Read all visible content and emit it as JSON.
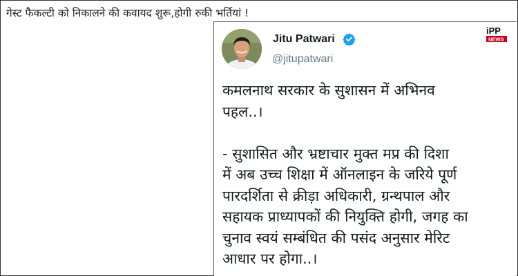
{
  "headline": "गेस्ट फैकल्टी को निकालने की कवायद शुरू,होगी रुकी भर्तियां !",
  "tweet": {
    "author_name": "Jitu Patwari",
    "author_handle": "@jitupatwari",
    "verified_icon": "verified-badge-icon",
    "verified_color": "#1da1f2",
    "avatar_icon": "profile-photo",
    "text": "कमलनाथ सरकार के सुशासन में अभिनव\nपहल..।\n\n- सुशासित और भ्रष्टाचार मुक्त मप्र की दिशा\nमें अब उच्च शिक्षा में ऑनलाइन के जरिये पूर्ण\nपारदर्शिता से क्रीड़ा अधिकारी, ग्रन्थपाल और\nसहायक प्राध्यापकों की नियुक्ति होगी, जगह का\nचुनाव स्वयं सम्बंधित की पसंद अनुसार मेरिट\nआधार पर होगा..।"
  },
  "watermark": {
    "top": "iPP",
    "bottom": "NEWS",
    "accent_color": "#d0021b"
  }
}
